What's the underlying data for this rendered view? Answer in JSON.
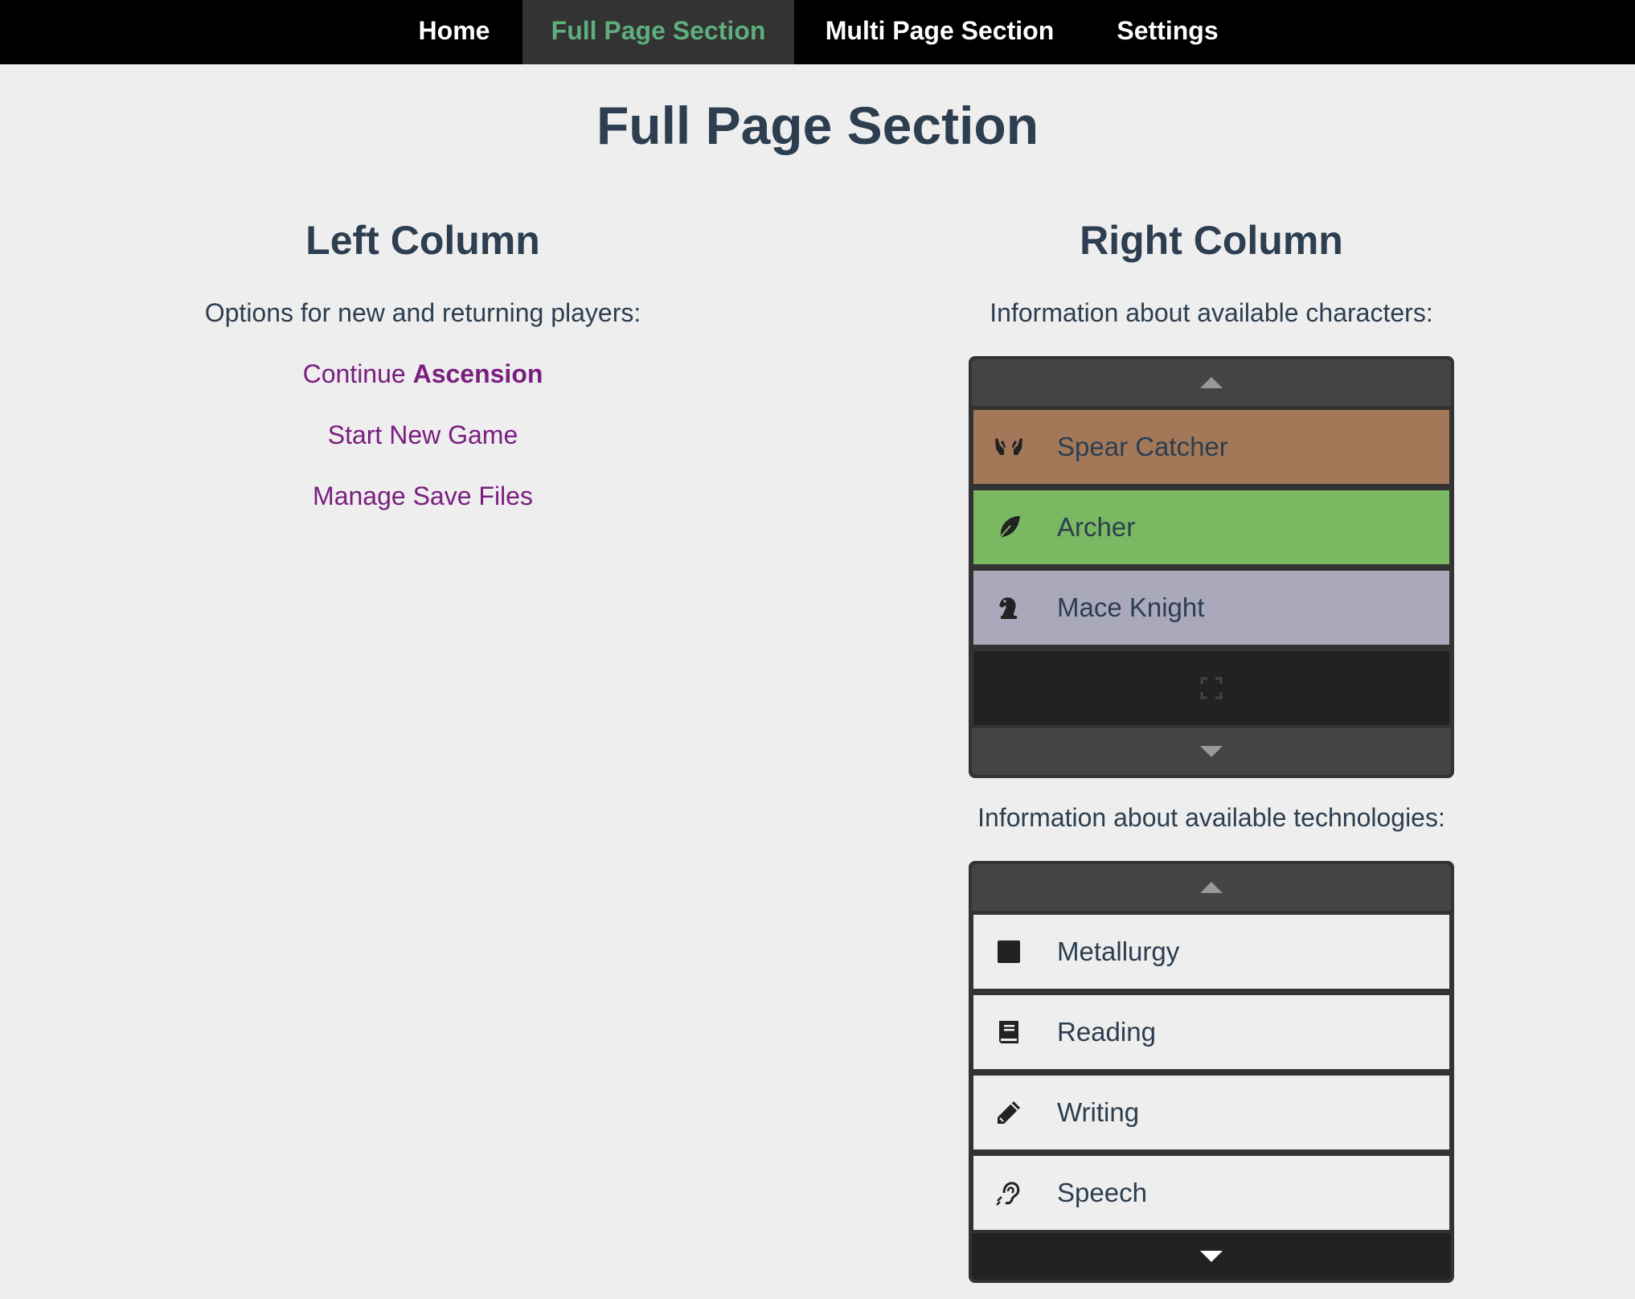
{
  "nav": {
    "items": [
      {
        "label": "Home"
      },
      {
        "label": "Full Page Section"
      },
      {
        "label": "Multi Page Section"
      },
      {
        "label": "Settings"
      }
    ],
    "active_index": 1
  },
  "page": {
    "title": "Full Page Section"
  },
  "left": {
    "title": "Left Column",
    "subtitle": "Options for new and returning players:",
    "links": {
      "continue_prefix": "Continue",
      "continue_name": "Ascension",
      "new_game": "Start New Game",
      "manage_saves": "Manage Save Files"
    }
  },
  "right": {
    "title": "Right Column",
    "characters_caption": "Information about available characters:",
    "technologies_caption": "Information about available technologies:",
    "characters": [
      {
        "name": "Spear Catcher",
        "icon": "hands-icon",
        "color": "#a37858"
      },
      {
        "name": "Archer",
        "icon": "feather-icon",
        "color": "#7ab862"
      },
      {
        "name": "Mace Knight",
        "icon": "chess-knight-icon",
        "color": "#a9a9bb"
      }
    ],
    "technologies": [
      {
        "name": "Metallurgy",
        "icon": "square-icon"
      },
      {
        "name": "Reading",
        "icon": "book-icon"
      },
      {
        "name": "Writing",
        "icon": "pencil-icon"
      },
      {
        "name": "Speech",
        "icon": "listening-ear-icon"
      }
    ]
  },
  "colors": {
    "nav_bg": "#000000",
    "nav_active_bg": "#333333",
    "nav_active_text": "#5eae7e",
    "link": "#7a1e80",
    "heading": "#2c3e50",
    "page_bg": "#eeeeee",
    "list_frame": "#333333",
    "tech_row_bg": "#eeeeee"
  }
}
